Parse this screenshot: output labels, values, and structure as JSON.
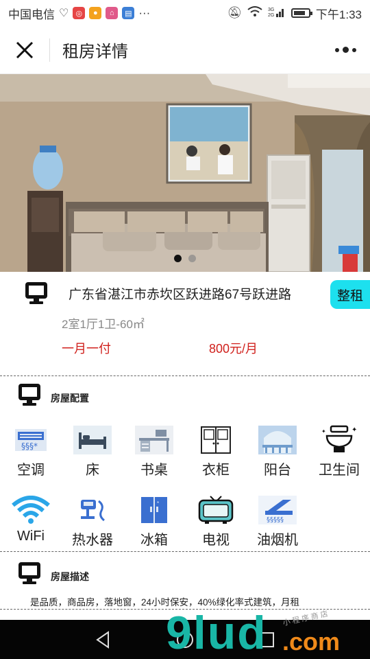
{
  "status_bar": {
    "carrier": "中国电信",
    "time": "下午1:33"
  },
  "nav": {
    "title": "租房详情"
  },
  "listing": {
    "address": "广东省湛江市赤坎区跃进路67号跃进路",
    "rent_type": "整租",
    "layout": "2室1厅1卫-60㎡",
    "payment_term": "一月一付",
    "price": "800元/月"
  },
  "config_section": {
    "title": "房屋配置",
    "row1": [
      {
        "label": "空调",
        "icon": "air-conditioner-icon"
      },
      {
        "label": "床",
        "icon": "bed-icon"
      },
      {
        "label": "书桌",
        "icon": "desk-icon"
      },
      {
        "label": "衣柜",
        "icon": "wardrobe-icon"
      },
      {
        "label": "阳台",
        "icon": "balcony-icon"
      },
      {
        "label": "卫生间",
        "icon": "toilet-icon"
      }
    ],
    "row2": [
      {
        "label": "WiFi",
        "icon": "wifi-icon"
      },
      {
        "label": "热水器",
        "icon": "water-heater-icon"
      },
      {
        "label": "冰箱",
        "icon": "fridge-icon"
      },
      {
        "label": "电视",
        "icon": "tv-icon"
      },
      {
        "label": "油烟机",
        "icon": "range-hood-icon"
      }
    ]
  },
  "description_section": {
    "title": "房屋描述",
    "text": "是品质，商品房，落地窗，24小时保安，40%绿化率式建筑，月租"
  },
  "watermark": {
    "brand": "9lud",
    "tld": ".com",
    "tagline": "小程序商店"
  },
  "colors": {
    "accent_cyan": "#1de0ee",
    "price_red": "#d0201c",
    "icon_blue": "#3a7ad8"
  }
}
